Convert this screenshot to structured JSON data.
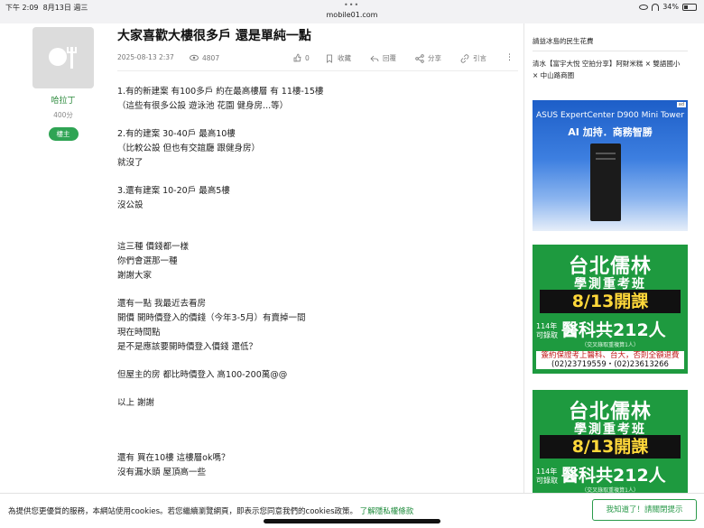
{
  "status": {
    "time": "下午 2:09",
    "date": "8月13日 週三",
    "url": "mobile01.com",
    "battery": "34%",
    "battery_level": 0.34
  },
  "author": {
    "name": "哈拉丁",
    "points": "400分",
    "badge": "樓主"
  },
  "post": {
    "title": "大家喜歡大樓很多戶 還是單純一點",
    "date": "2025-08-13 2:37",
    "views": "4807",
    "likes": "0",
    "favorite": "收藏",
    "reply": "回覆",
    "share": "分享",
    "quote": "引言",
    "lines": [
      "1.有的新建案 有100多戶 約在最高樓層 有 11樓-15樓",
      "（這些有很多公設 遊泳池 花園 健身房...等）",
      "",
      "2.有的建案 30-40戶 最高10樓",
      "（比較公設 但也有交誼廳 跟健身房）",
      "就沒了",
      "",
      "3.還有建案 10-20戶 最高5樓",
      "沒公設",
      "",
      "",
      "這三種 價錢都一樣",
      "你們會選那一種",
      "謝謝大家",
      "",
      "還有一點 我最近去看房",
      "開價 開時價登入的價錢（今年3-5月）有賣掉一間",
      "現在時間點",
      "是不是應該要開時價登入價錢 還低？",
      "",
      "但屋主的房 都比時價登入 高100-200萬@@",
      "",
      "以上 謝謝",
      "",
      "",
      "",
      "還有 買在10樓 這樓層ok嗎？",
      "沒有漏水頭 屋頂高一些"
    ]
  },
  "sidebar": {
    "link1": "請益冰島的民生花費",
    "link2": "清水【富宇大悅 空拍分享】阿財米糕 × 雙語國小 × 中山路商圈"
  },
  "ads": {
    "asus": {
      "line1": "ASUS ExpertCenter D900 Mini Tower",
      "line2": "AI 加持．商務智勝",
      "tag": "ad"
    },
    "cram": {
      "name": "台北儒林",
      "sub": "學測重考班",
      "date": "8/13開課",
      "year": "114年",
      "year2": "可錄取",
      "count": "醫科共212人",
      "note": "（交叉錄取重複算1人）",
      "phone1": "簽約保證考上醫科、台大，否則全額退費",
      "phone2": "(02)23719559・(02)23613266"
    }
  },
  "cookie": {
    "text": "為提供您更優質的服務，本網站使用cookies。若您繼續瀏覽網頁，即表示您同意我們的cookies政策。",
    "link": "了解隱私權條款",
    "button": "我知道了！請關閉提示"
  },
  "colors": {
    "accent": "#2fa454",
    "ad_green": "#1e9a3f",
    "ad_blue": "#1d5ec8"
  },
  "icons": [
    "avatar-placeholder",
    "eye-icon",
    "thumb-up-icon",
    "bookmark-icon",
    "reply-icon",
    "share-icon",
    "quote-icon",
    "more-icon"
  ]
}
